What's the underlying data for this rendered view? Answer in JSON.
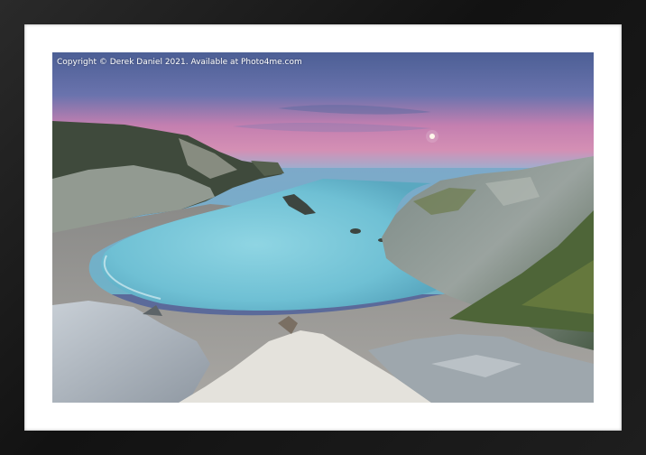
{
  "image": {
    "subject": "cove-coastline-at-dusk",
    "credit_text": "Copyright © Derek Daniel 2021. Available at Photo4me.com"
  },
  "colors": {
    "frame": "#1b1b1b",
    "mount": "#ffffff",
    "sky_top": "#5c6fa6",
    "sky_glow": "#d07fae",
    "sea": "#6fb3cc",
    "cove_water": "#7fcfe0"
  }
}
